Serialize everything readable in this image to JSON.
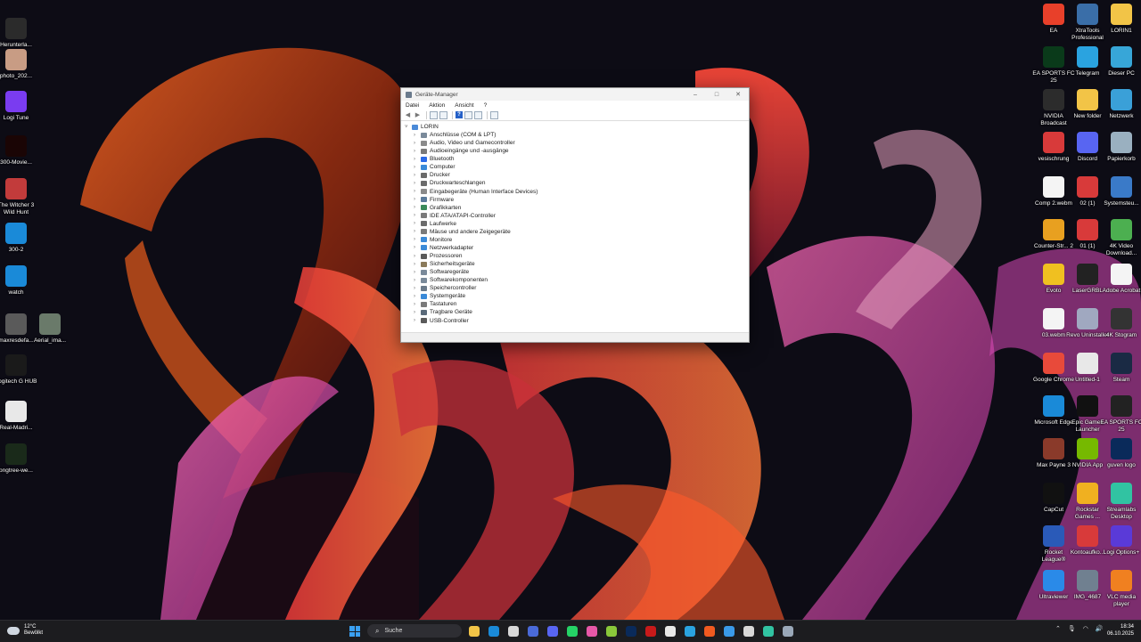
{
  "desktop": {
    "left_icons": [
      {
        "label": "Herunterla...",
        "icon": "download-folder-icon",
        "color": "#2b2b2b"
      },
      {
        "label": "photo_202...",
        "icon": "photo-thumbnail-icon",
        "color": "#c89c84"
      },
      {
        "label": "Logi Tune",
        "icon": "logi-tune-icon",
        "color": "#7a3cf0"
      },
      {
        "label": "300-Movie...",
        "icon": "movie-300-icon",
        "color": "#1a0505"
      },
      {
        "label": "The Witcher 3 Wild Hunt",
        "icon": "witcher-icon",
        "color": "#c23b3b"
      },
      {
        "label": "300-2",
        "icon": "edge-icon",
        "color": "#1a8ad8"
      },
      {
        "label": "watch",
        "icon": "edge-icon",
        "color": "#1a8ad8"
      },
      {
        "label": "maxresdefa...",
        "icon": "image-thumbnail-icon",
        "color": "#5a5a5a"
      },
      {
        "label": "Aerial_ima...",
        "icon": "image-thumbnail-icon",
        "color": "#6a7a6a"
      },
      {
        "label": "Logitech G HUB",
        "icon": "logitech-g-icon",
        "color": "#1a1a1a"
      },
      {
        "label": "Real-Madri...",
        "icon": "real-madrid-icon",
        "color": "#e8e8e8"
      },
      {
        "label": "pngtree-we...",
        "icon": "png-image-icon",
        "color": "#1a2a1a"
      }
    ],
    "right_icons": [
      {
        "label": "EA",
        "icon": "ea-icon",
        "color": "#e8402a"
      },
      {
        "label": "XtraTools Professional",
        "icon": "xtratools-icon",
        "color": "#3a6ea8"
      },
      {
        "label": "LORIN1",
        "icon": "folder-icon",
        "color": "#f2c447"
      },
      {
        "label": "EA SPORTS FC 25",
        "icon": "fc25-icon",
        "color": "#0a3a1a"
      },
      {
        "label": "Telegram",
        "icon": "telegram-icon",
        "color": "#2aa3e0"
      },
      {
        "label": "Dieser PC",
        "icon": "pc-icon",
        "color": "#37a6d8"
      },
      {
        "label": "NVIDIA Broadcast",
        "icon": "nvidia-broadcast-icon",
        "color": "#2c2c2c"
      },
      {
        "label": "New folder",
        "icon": "folder-icon",
        "color": "#f2c447"
      },
      {
        "label": "Netzwerk",
        "icon": "network-icon",
        "color": "#3aa0d8"
      },
      {
        "label": "vesischrung",
        "icon": "pdf-icon",
        "color": "#d83a3a"
      },
      {
        "label": "Discord",
        "icon": "discord-icon",
        "color": "#5865f2"
      },
      {
        "label": "Papierkorb",
        "icon": "recycle-bin-icon",
        "color": "#9ab0c0"
      },
      {
        "label": "Comp 2.webm",
        "icon": "file-icon",
        "color": "#f4f4f4"
      },
      {
        "label": "02 (1)",
        "icon": "pdf-icon",
        "color": "#d83a3a"
      },
      {
        "label": "Systemsteu...",
        "icon": "control-panel-icon",
        "color": "#3a7ac8"
      },
      {
        "label": "Counter-Str... 2",
        "icon": "cs2-icon",
        "color": "#e8a020"
      },
      {
        "label": "01 (1)",
        "icon": "pdf-icon",
        "color": "#d83a3a"
      },
      {
        "label": "4K Video Download...",
        "icon": "4k-video-icon",
        "color": "#4caf50"
      },
      {
        "label": "Evoto",
        "icon": "evoto-icon",
        "color": "#f0c020"
      },
      {
        "label": "LaserGRBL",
        "icon": "lasergrbl-icon",
        "color": "#222222"
      },
      {
        "label": "Adobe Acrobat",
        "icon": "file-icon",
        "color": "#f4f4f4"
      },
      {
        "label": "03.webm",
        "icon": "file-icon",
        "color": "#f4f4f4"
      },
      {
        "label": "Revo Uninstaller",
        "icon": "revo-icon",
        "color": "#a0a8c0"
      },
      {
        "label": "4K Stogram",
        "icon": "4k-icon",
        "color": "#333333"
      },
      {
        "label": "Google Chrome",
        "icon": "chrome-icon",
        "color": "#e84a3a"
      },
      {
        "label": "Untitled-1",
        "icon": "file-icon",
        "color": "#e8e8e8"
      },
      {
        "label": "Steam",
        "icon": "steam-icon",
        "color": "#1a2a44"
      },
      {
        "label": "Microsoft Edge",
        "icon": "edge-icon",
        "color": "#1a8ad8"
      },
      {
        "label": "Epic Games Launcher",
        "icon": "epic-games-icon",
        "color": "#111111"
      },
      {
        "label": "EA SPORTS FC 25",
        "icon": "fc25-icon",
        "color": "#222222"
      },
      {
        "label": "Max Payne 3",
        "icon": "max-payne-icon",
        "color": "#8a3a2a"
      },
      {
        "label": "NVIDIA App",
        "icon": "nvidia-icon",
        "color": "#76b900"
      },
      {
        "label": "guven logo",
        "icon": "photoshop-file-icon",
        "color": "#0a2a5a"
      },
      {
        "label": "CapCut",
        "icon": "capcut-icon",
        "color": "#111111"
      },
      {
        "label": "Rockstar Games ...",
        "icon": "rockstar-icon",
        "color": "#f0b020"
      },
      {
        "label": "Streamlabs Desktop",
        "icon": "streamlabs-icon",
        "color": "#31c3a2"
      },
      {
        "label": "Rocket League®",
        "icon": "rocket-league-icon",
        "color": "#2a5ab8"
      },
      {
        "label": "Kontoaufko...",
        "icon": "pdf-icon",
        "color": "#d83a3a"
      },
      {
        "label": "Logi Options+",
        "icon": "logi-options-icon",
        "color": "#5a3ad8"
      },
      {
        "label": "Ultraviewer",
        "icon": "ultraviewer-icon",
        "color": "#2a8ae8"
      },
      {
        "label": "IMG_4687",
        "icon": "image-thumbnail-icon",
        "color": "#708090"
      },
      {
        "label": "VLC media player",
        "icon": "vlc-icon",
        "color": "#f08020"
      }
    ]
  },
  "window": {
    "title": "Geräte-Manager",
    "controls": {
      "minimize": "–",
      "maximize": "□",
      "close": "✕"
    },
    "menu": [
      "Datei",
      "Aktion",
      "Ansicht",
      "?"
    ],
    "tree": {
      "root": "LORIN",
      "categories": [
        {
          "label": "Anschlüsse (COM & LPT)",
          "color": "#7a8a9a"
        },
        {
          "label": "Audio, Video und Gamecontroller",
          "color": "#8a8a8a"
        },
        {
          "label": "Audioeingänge und -ausgänge",
          "color": "#7a7a7a"
        },
        {
          "label": "Bluetooth",
          "color": "#2a6ae8"
        },
        {
          "label": "Computer",
          "color": "#3a8ad8"
        },
        {
          "label": "Drucker",
          "color": "#6a6a6a"
        },
        {
          "label": "Druckwarteschlangen",
          "color": "#6a6a6a"
        },
        {
          "label": "Eingabegeräte (Human Interface Devices)",
          "color": "#8a8a8a"
        },
        {
          "label": "Firmware",
          "color": "#5a7a9a"
        },
        {
          "label": "Grafikkarten",
          "color": "#3a8a5a"
        },
        {
          "label": "IDE ATA/ATAPI-Controller",
          "color": "#7a7a7a"
        },
        {
          "label": "Laufwerke",
          "color": "#6a6a6a"
        },
        {
          "label": "Mäuse und andere Zeigegeräte",
          "color": "#7a7a7a"
        },
        {
          "label": "Monitore",
          "color": "#3a8ad8"
        },
        {
          "label": "Netzwerkadapter",
          "color": "#3a8ad8"
        },
        {
          "label": "Prozessoren",
          "color": "#5a5a5a"
        },
        {
          "label": "Sicherheitsgeräte",
          "color": "#8a7a5a"
        },
        {
          "label": "Softwaregeräte",
          "color": "#7a8a9a"
        },
        {
          "label": "Softwarekomponenten",
          "color": "#7a8a9a"
        },
        {
          "label": "Speichercontroller",
          "color": "#6a7a8a"
        },
        {
          "label": "Systemgeräte",
          "color": "#3a8ad8"
        },
        {
          "label": "Tastaturen",
          "color": "#7a7a7a"
        },
        {
          "label": "Tragbare Geräte",
          "color": "#5a6a7a"
        },
        {
          "label": "USB-Controller",
          "color": "#5a5a5a"
        }
      ]
    }
  },
  "taskbar": {
    "weather": {
      "temp": "12°C",
      "condition": "Bewölkt"
    },
    "search_label": "Suche",
    "apps": [
      {
        "name": "file-explorer-icon",
        "color": "#f2c447"
      },
      {
        "name": "edge-icon",
        "color": "#1a8ad8"
      },
      {
        "name": "store-icon",
        "color": "#d8d8d8"
      },
      {
        "name": "terminal-icon",
        "color": "#4a6ad8"
      },
      {
        "name": "discord-icon",
        "color": "#5865f2"
      },
      {
        "name": "whatsapp-icon",
        "color": "#25d366"
      },
      {
        "name": "app-icon",
        "color": "#e858a8"
      },
      {
        "name": "xbox-icon",
        "color": "#8ac83a"
      },
      {
        "name": "photoshop-icon",
        "color": "#0a2a5a"
      },
      {
        "name": "red-app-icon",
        "color": "#c81a1a"
      },
      {
        "name": "chrome-icon",
        "color": "#e8e8e8"
      },
      {
        "name": "telegram-icon",
        "color": "#2aa3e0"
      },
      {
        "name": "brave-icon",
        "color": "#f05a20"
      },
      {
        "name": "safari-icon",
        "color": "#3a9ae8"
      },
      {
        "name": "chatgpt-icon",
        "color": "#d8d8d8"
      },
      {
        "name": "streamlabs-icon",
        "color": "#31c3a2"
      },
      {
        "name": "device-manager-icon",
        "color": "#9aa8b8"
      }
    ],
    "tray": {
      "chevron": "⌃",
      "mic": "🎙",
      "wifi": "◠",
      "volume": "🔊"
    },
    "clock": {
      "time": "18:34",
      "date": "06.10.2025"
    }
  },
  "colors": {
    "accent": "#3aa0f2",
    "window_bg": "#ffffff",
    "taskbar_bg": "#1c1c1f"
  }
}
